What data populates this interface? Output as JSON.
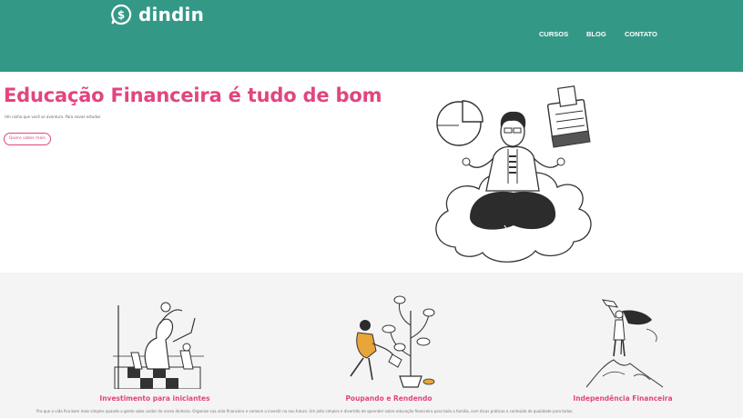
{
  "brand": {
    "name": "dindin",
    "logo_icon": "dollar-chat-icon"
  },
  "nav": {
    "items": [
      {
        "label": "CURSOS"
      },
      {
        "label": "BLOG"
      },
      {
        "label": "CONTATO"
      }
    ]
  },
  "hero": {
    "title": "Educação Financeira é tudo de bom",
    "subtitle": "Um ninho que você se aventura. Para novos estudos",
    "button_label": "Quero saber mais"
  },
  "features": [
    {
      "title": "Investimento para iniciantes"
    },
    {
      "title": "Poupando e Rendendo"
    },
    {
      "title": "Independência Financeira"
    }
  ],
  "features_description": "Pra que a vida fica bem mais simples quando a gente sabe cuidar do nosso dinheiro. Organize sua vida financeira e comece a investir no seu futuro. Um jeito simples e divertido de aprender sobre educação financeira para toda a família, com dicas práticas e conteúdo de qualidade para todos.",
  "colors": {
    "header": "#349887",
    "accent": "#e2457f",
    "features_bg": "#f4f4f4"
  }
}
